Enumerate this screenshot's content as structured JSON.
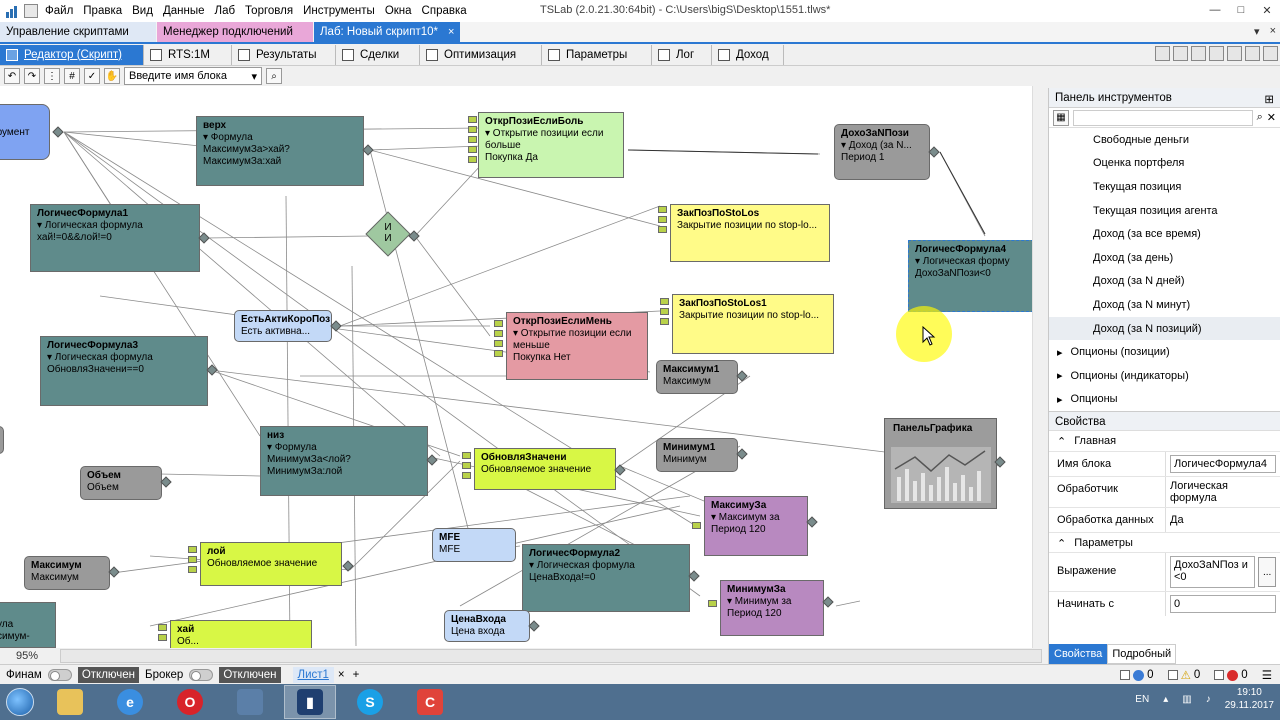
{
  "window": {
    "title": "TSLab (2.0.21.30:64bit) - C:\\Users\\bigS\\Desktop\\1551.tlws*",
    "minimize": "—",
    "maximize": "□",
    "close": "✕"
  },
  "menu": [
    "Файл",
    "Правка",
    "Вид",
    "Данные",
    "Лаб",
    "Торговля",
    "Инструменты",
    "Окна",
    "Справка"
  ],
  "doc_tabs": [
    {
      "label": "Управление скриптами",
      "close": ""
    },
    {
      "label": "Менеджер подключений",
      "close": ""
    },
    {
      "label": "Лаб: Новый скрипт10*",
      "close": "×"
    }
  ],
  "doc_tabs_right": [
    "▾",
    "×"
  ],
  "view_tabs": [
    "Редактор (Скрипт)",
    "RTS:1M",
    "Результаты",
    "Сделки",
    "Оптимизация",
    "Параметры",
    "Лог",
    "Доход"
  ],
  "toolbar": {
    "block_placeholder": "Введите имя блока",
    "combo_arrow": "▾"
  },
  "canvas": {
    "zoom": "95%",
    "nodes": {
      "instrument": {
        "title": "струмент"
      },
      "verh": {
        "title": "верх",
        "line1": "▾ Формула",
        "line2": "МаксимумЗа>хай?",
        "line3": "МаксимумЗа:хай"
      },
      "logic1": {
        "title": "ЛогичесФормула1",
        "line1": "▾ Логическая формула",
        "line2": "хай!=0&&лой!=0"
      },
      "and_gate": {
        "line1": "И",
        "line2": "И"
      },
      "open_long": {
        "title": "ОткрПозиЕслиБоль",
        "line1": "▾ Открытие позиции если",
        "line2": "больше",
        "line3": "Покупка       Да"
      },
      "income_n": {
        "title": "ДохоЗаNПози",
        "line1": "▾ Доход (за N...",
        "line2": "Период         1"
      },
      "close_stop1": {
        "title": "ЗакПозПоStoLos",
        "line1": "Закрытие позиции по stop-lo..."
      },
      "logic4": {
        "title": "ЛогичесФормула4",
        "line1": "▾ Логическая форму",
        "line2": "ДохоЗаNПози<0"
      },
      "active_pos": {
        "title": "ЕстьАктиКороПоз",
        "line1": "Есть активна..."
      },
      "close_stop2": {
        "title": "ЗакПозПоStoLos1",
        "line1": "Закрытие позиции по stop-lo..."
      },
      "open_short": {
        "title": "ОткрПозиЕслиМень",
        "line1": "▾ Открытие позиции если",
        "line2": "меньше",
        "line3": "Покупка       Нет"
      },
      "logic3": {
        "title": "ЛогичесФормула3",
        "line1": "▾ Логическая формула",
        "line2": "ОбновляЗначени==0"
      },
      "max1": {
        "title": "Максимум1",
        "line1": "Максимум"
      },
      "niz": {
        "title": "низ",
        "line1": "▾ Формула",
        "line2": "МинимумЗа<лой?",
        "line3": "МинимумЗа:лой"
      },
      "update_val": {
        "title": "ОбновляЗначени",
        "line1": "Обновляемое значение"
      },
      "min1": {
        "title": "Минимум1",
        "line1": "Минимум"
      },
      "chart_panel": {
        "title": "ПанельГрафика"
      },
      "volume": {
        "title": "Объем",
        "line1": "Объем"
      },
      "max_for": {
        "title": "МаксимуЗа",
        "line1": "▾ Максимум за",
        "line2": "Период      120"
      },
      "maximum": {
        "title": "Максимум",
        "line1": "Максимум"
      },
      "loy": {
        "title": "лой",
        "line1": "Обновляемое значение"
      },
      "mfe": {
        "title": "MFE",
        "line1": "MFE"
      },
      "logic2": {
        "title": "ЛогичесФормула2",
        "line1": "▾ Логическая формула",
        "line2": "ЦенаВхода!=0"
      },
      "min_for": {
        "title": "МинимумЗа",
        "line1": "▾ Минимум за",
        "line2": "Период      120"
      },
      "entry_price": {
        "title": "ЦенаВхода",
        "line1": "Цена входа"
      },
      "hay": {
        "title": "хай",
        "line1": "Об..."
      },
      "logic_left": {
        "line1": "ула",
        "line2": "симум-"
      }
    }
  },
  "tools_panel": {
    "title": "Панель инструментов",
    "items": [
      "Свободные деньги",
      "Оценка портфеля",
      "Текущая позиция",
      "Текущая позиция агента",
      "Доход (за все время)",
      "Доход (за день)",
      "Доход (за N дней)",
      "Доход (за N минут)",
      "Доход (за N позиций)"
    ],
    "groups": [
      "Опционы (позиции)",
      "Опционы (индикаторы)",
      "Опционы"
    ]
  },
  "properties": {
    "title": "Свойства",
    "section_main": "Главная",
    "section_params": "Параметры",
    "rows": [
      {
        "key": "Имя блока",
        "value": "ЛогичесФормула4"
      },
      {
        "key": "Обработчик",
        "value": "Логическая формула"
      },
      {
        "key": "Обработка данных",
        "value": "Да"
      }
    ],
    "expression": {
      "key": "Выражение",
      "value": "ДохоЗаNПоз и<0",
      "button": "..."
    },
    "start_from": {
      "key": "Начинать с",
      "value": "0"
    },
    "tabs": [
      "Свойства",
      "Подробный"
    ]
  },
  "statusbar": {
    "finam_label": "Финам",
    "finam_state": "Отключен",
    "broker_label": "Брокер",
    "broker_state": "Отключен",
    "sheet_tab": "Лист1",
    "counters": [
      "0",
      "0",
      "0"
    ]
  },
  "taskbar": {
    "lang": "EN",
    "time": "19:10",
    "date": "29.11.2017"
  },
  "colors": {
    "accent": "#2b78d2",
    "teal_block": "#5f8b8b",
    "highlight": "#fffa00"
  }
}
